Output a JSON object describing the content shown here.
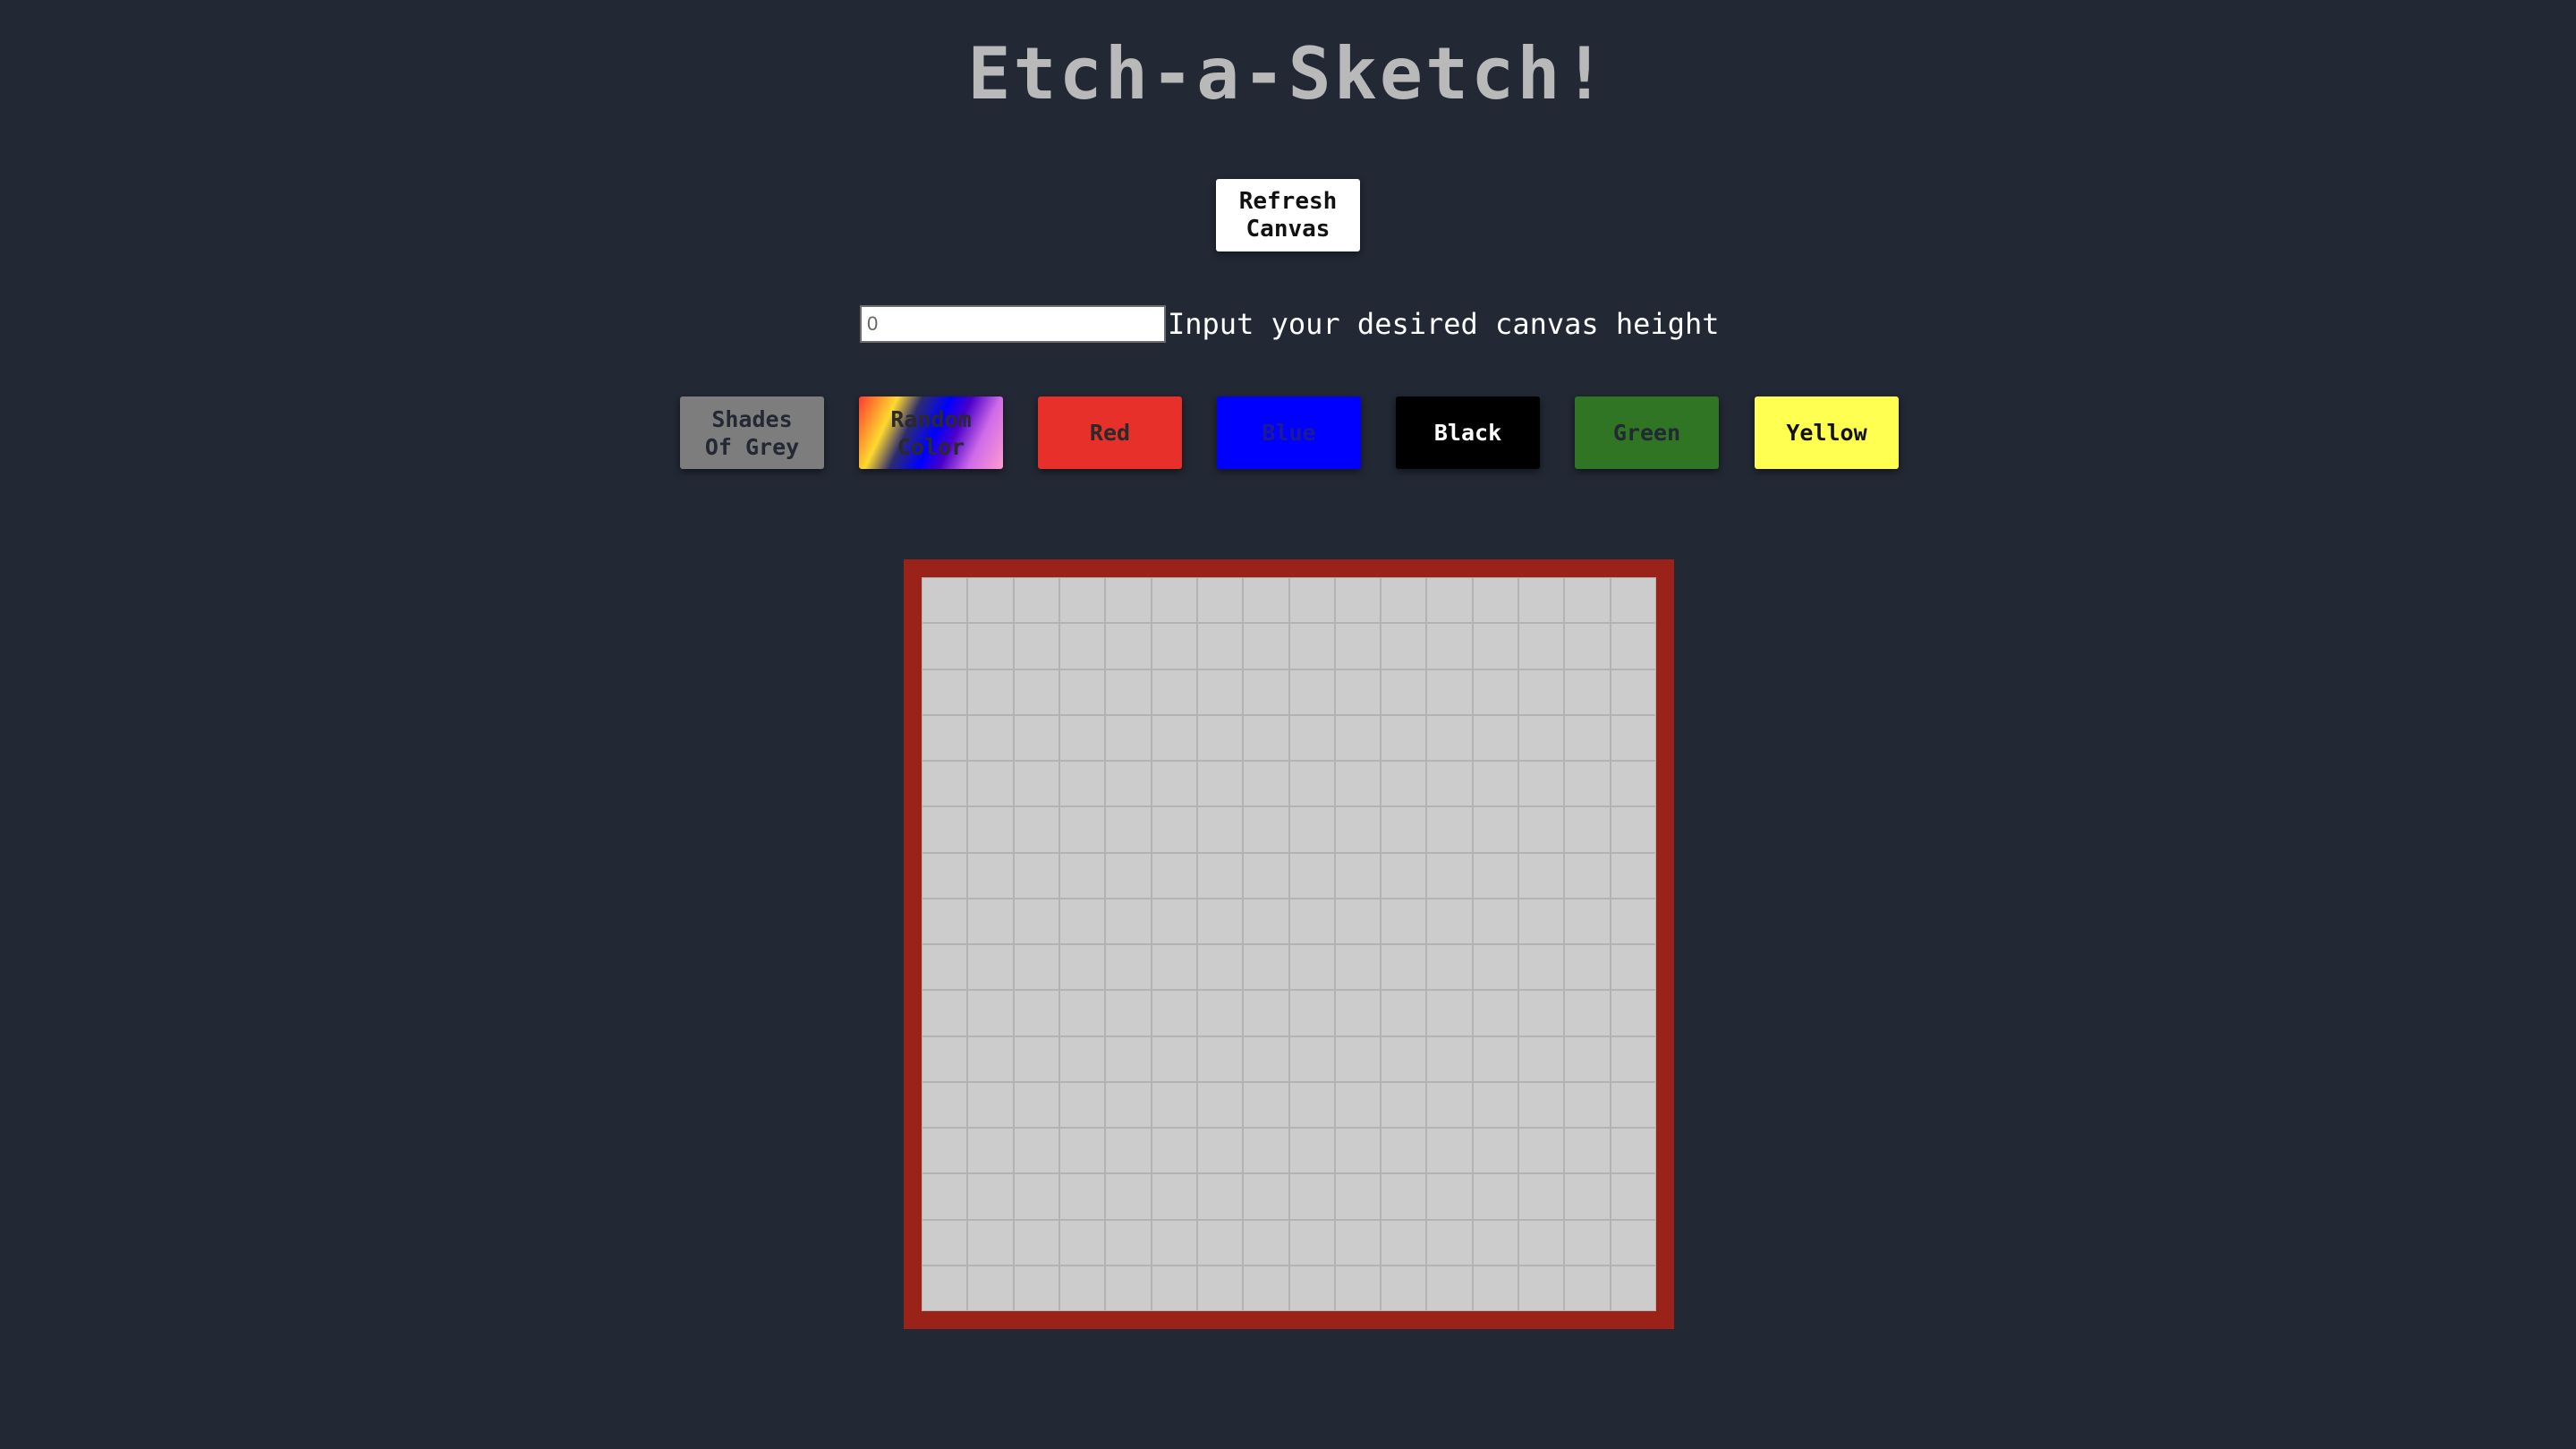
{
  "title": "Etch-a-Sketch!",
  "controls": {
    "refresh_label": "Refresh\nCanvas",
    "height_input_value": "0",
    "height_input_placeholder": "0",
    "height_label": "Input your desired canvas height"
  },
  "color_buttons": [
    {
      "label": "Shades\nOf Grey",
      "color": "#7d7d7d"
    },
    {
      "label": "Random\nColor",
      "color": "gradient"
    },
    {
      "label": "Red",
      "color": "#e8302a"
    },
    {
      "label": "Blue",
      "color": "#0000ff"
    },
    {
      "label": "Black",
      "color": "#000000"
    },
    {
      "label": "Green",
      "color": "#2f7524"
    },
    {
      "label": "Yellow",
      "color": "#ffff52"
    }
  ],
  "canvas": {
    "rows": 16,
    "columns": 16,
    "frame_color": "#9a2218",
    "cell_color": "#cccccc"
  }
}
